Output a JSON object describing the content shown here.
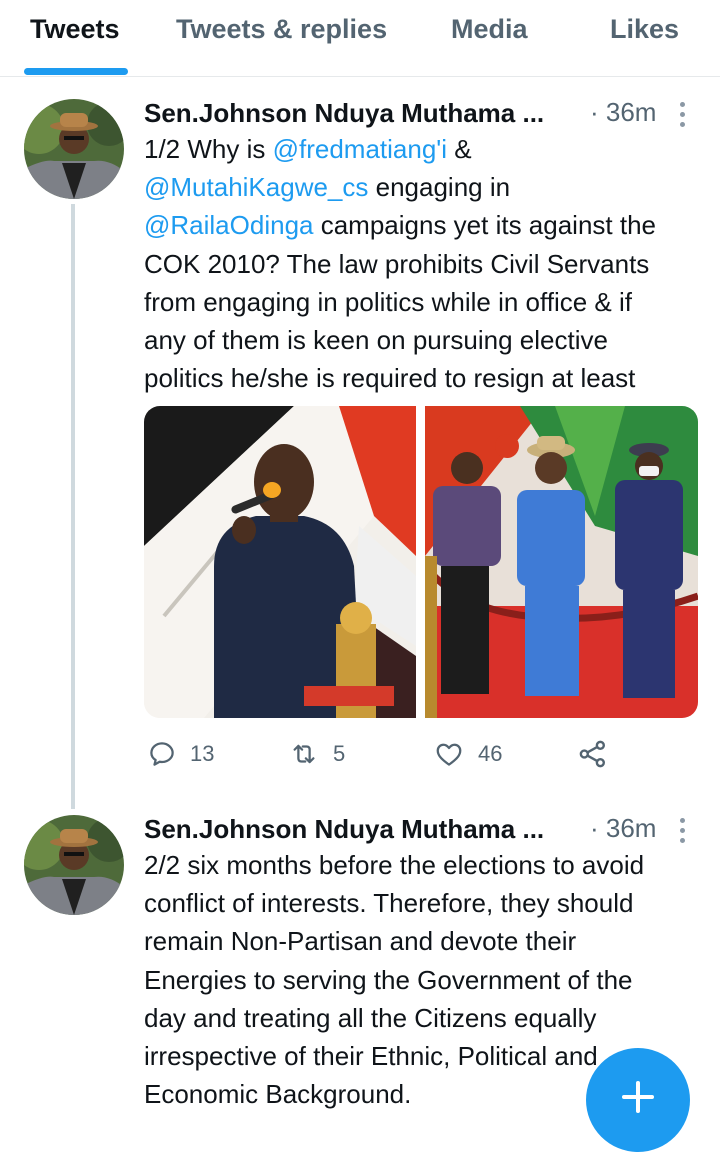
{
  "tabs": [
    {
      "label": "Tweets",
      "active": true
    },
    {
      "label": "Tweets & replies",
      "active": false
    },
    {
      "label": "Media",
      "active": false
    },
    {
      "label": "Likes",
      "active": false
    }
  ],
  "tweets": [
    {
      "author": "Sen.Johnson Nduya Muthama ...",
      "time": "· 36m",
      "lines": [
        [
          "1/2 Why is ",
          "@fredmatiang'i",
          " &"
        ],
        [
          "@MutahiKagwe_cs",
          " engaging in"
        ],
        [
          "@RailaOdinga",
          " campaigns yet its against the"
        ],
        [
          "COK 2010? The law prohibits Civil Servants"
        ],
        [
          "from engaging in politics while in office & if"
        ],
        [
          "any of them is keen on pursuing elective"
        ],
        [
          "politics he/she is required to resign at least"
        ]
      ],
      "replies": "13",
      "retweets": "5",
      "likes": "46"
    },
    {
      "author": "Sen.Johnson Nduya Muthama ...",
      "time": "· 36m",
      "lines": [
        [
          "2/2 six months before the elections to avoid"
        ],
        [
          "conflict of interests. Therefore, they should"
        ],
        [
          "remain Non-Partisan and devote their"
        ],
        [
          "Energies to serving the Government of the"
        ],
        [
          "day and treating all the Citizens equally"
        ],
        [
          "irrespective of their Ethnic, Political and"
        ],
        [
          "Economic Background."
        ]
      ]
    }
  ],
  "colors": {
    "accent": "#1d9bf0",
    "text": "#0f1419",
    "muted": "#536471"
  },
  "icons": [
    "reply-icon",
    "retweet-icon",
    "like-icon",
    "share-icon",
    "more-icon",
    "compose-plus-icon"
  ]
}
